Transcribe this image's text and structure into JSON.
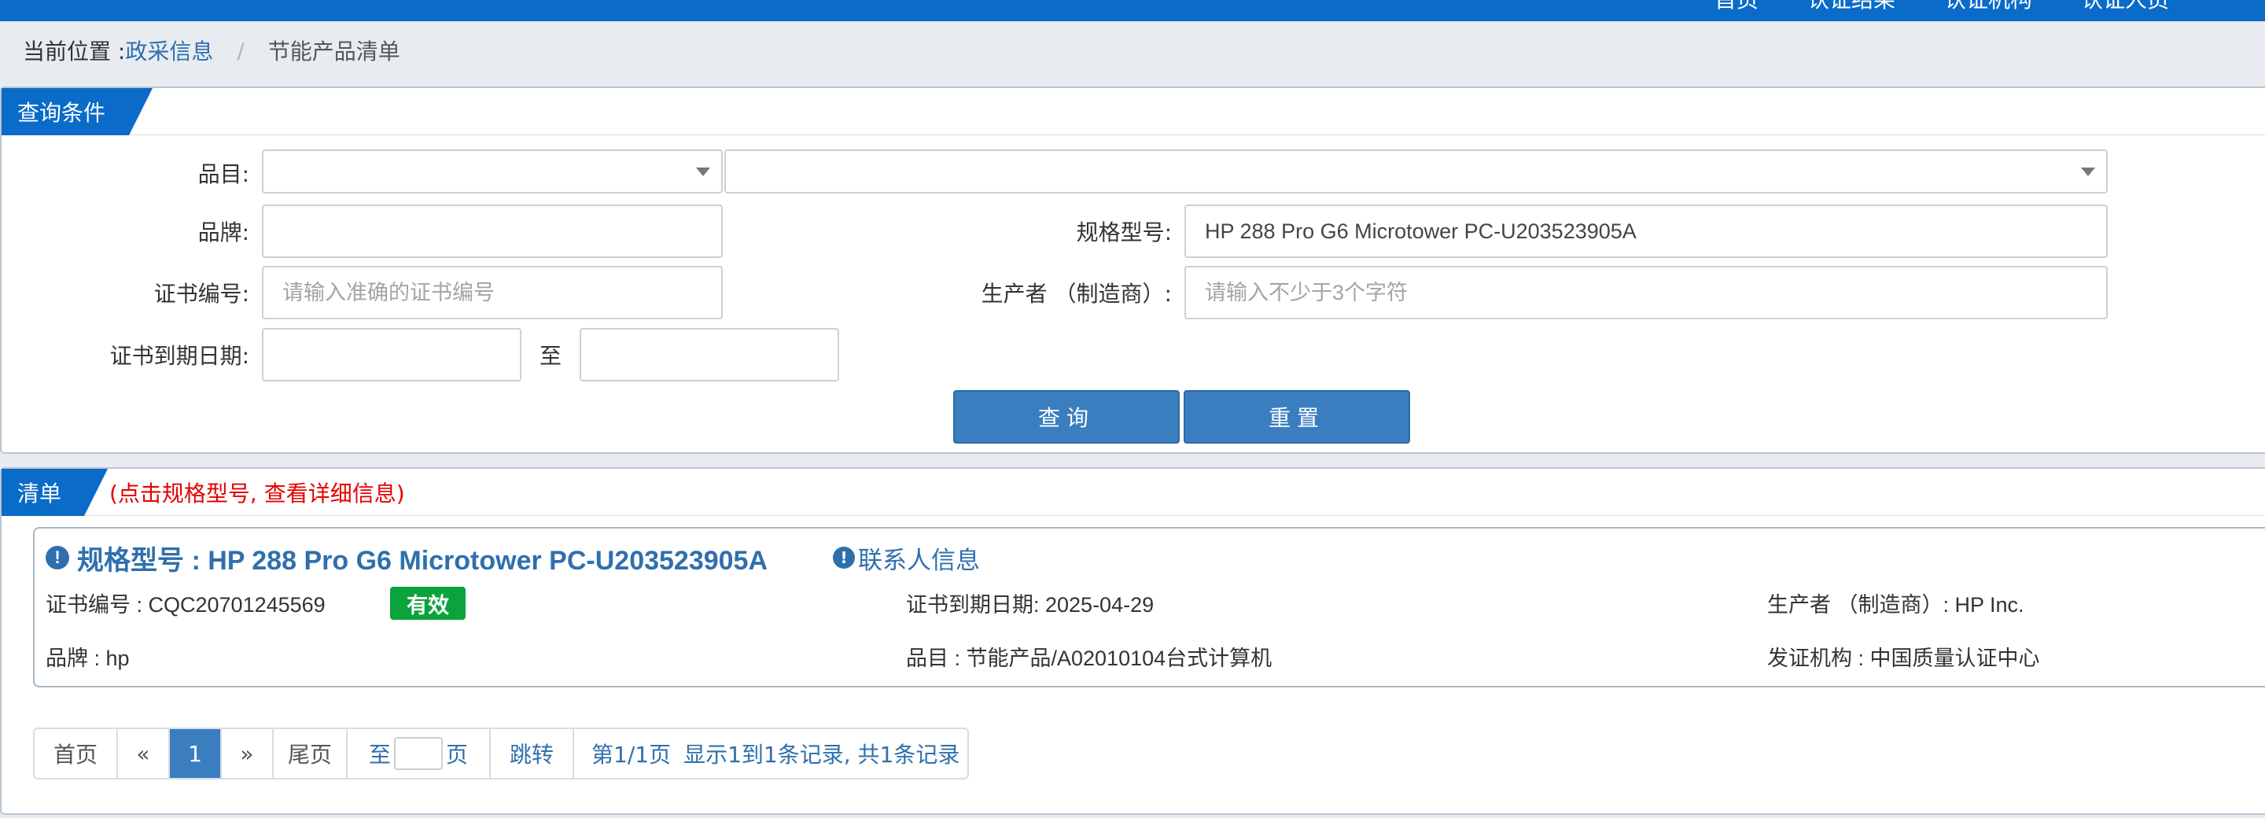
{
  "topnav": [
    "首页",
    "认证结果",
    "认证机构",
    "认证人员"
  ],
  "breadcrumb": {
    "prefix": "当前位置 : ",
    "link": "政采信息",
    "separator": "/",
    "current": "节能产品清单"
  },
  "query_panel": {
    "title": "查询条件",
    "category_label": "品目:",
    "category_value1": "",
    "category_value2": "",
    "brand_label": "品牌:",
    "brand_value": "",
    "model_label": "规格型号:",
    "model_value": "HP 288 Pro G6 Microtower PC-U203523905A",
    "cert_no_label": "证书编号:",
    "cert_no_placeholder": "请输入准确的证书编号",
    "maker_label": "生产者 （制造商）:",
    "maker_placeholder": "请输入不少于3个字符",
    "expiry_label": "证书到期日期:",
    "expiry_from": "",
    "expiry_to_label": "至",
    "expiry_to": "",
    "search_button": "查询",
    "reset_button": "重置"
  },
  "list_panel": {
    "title": "清单",
    "hint": "(点击规格型号, 查看详细信息)",
    "item": {
      "title": "规格型号 : HP 288 Pro G6 Microtower PC-U203523905A",
      "contact": "联系人信息",
      "cert_no": "证书编号 : CQC20701245569",
      "status": "有效",
      "expiry": "证书到期日期: 2025-04-29",
      "maker": "生产者 （制造商）: HP Inc.",
      "brand": "品牌 : hp",
      "category": "品目 : 节能产品/A02010104台式计算机",
      "issuer": "发证机构 : 中国质量认证中心"
    }
  },
  "pagination": {
    "first": "首页",
    "prev": "«",
    "current": "1",
    "next": "»",
    "last": "尾页",
    "goto_prefix": "至",
    "goto_suffix": "页",
    "jump": "跳转",
    "page_info": "第1/1页",
    "record_info": "显示1到1条记录, 共1条记录"
  },
  "colors": {
    "primary": "#0a6bc9",
    "button": "#3a7ec0",
    "link": "#2f6fae",
    "valid_badge": "#0aa33c",
    "hint_red": "#e60000"
  }
}
